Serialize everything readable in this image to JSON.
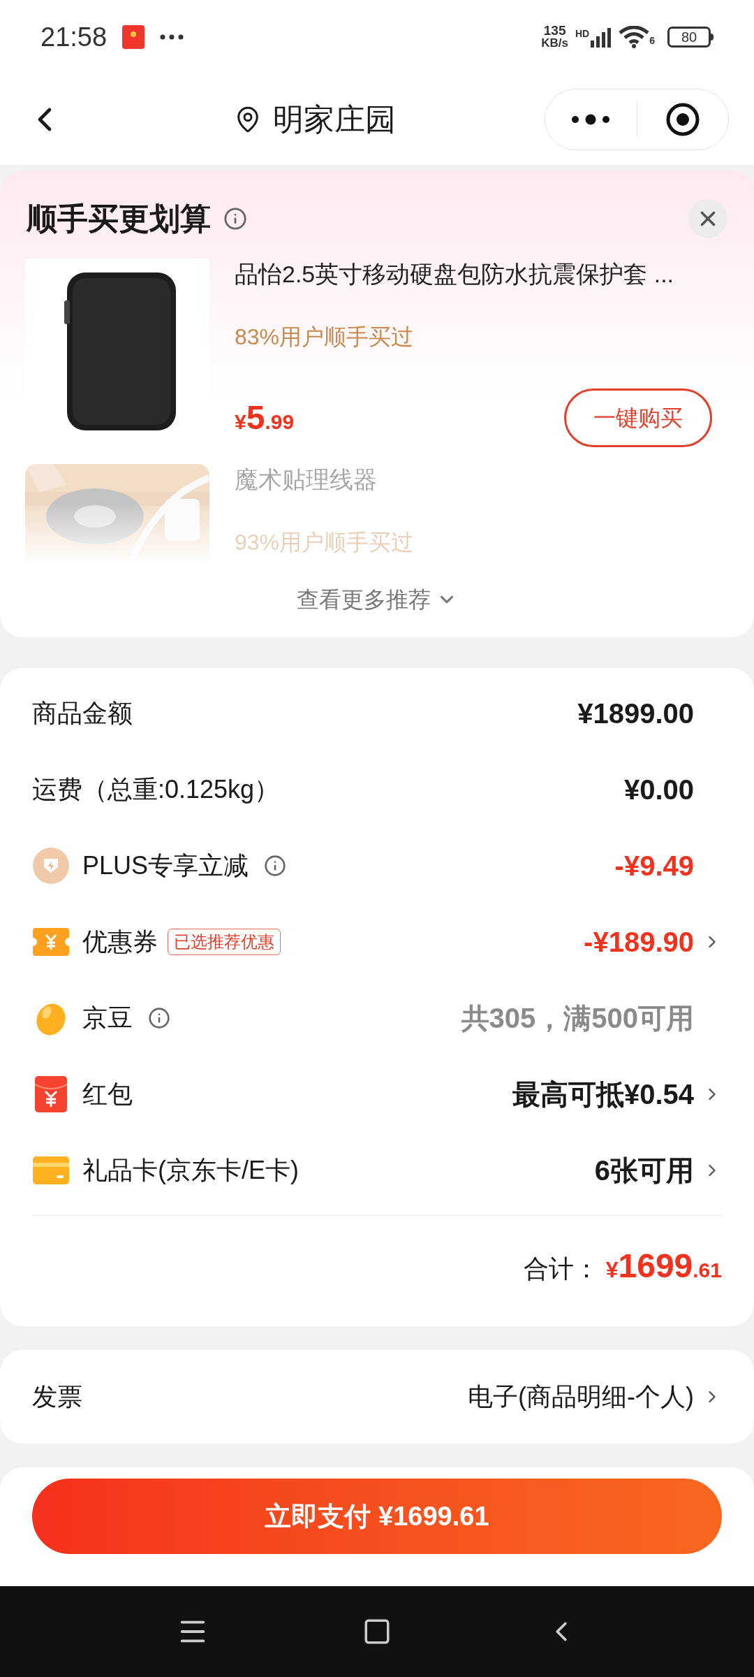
{
  "status_bar": {
    "time": "21:58",
    "net_speed": "135",
    "net_unit": "KB/s",
    "signal_label": "HD",
    "wifi_label": "6",
    "battery": "80"
  },
  "nav": {
    "title": "明家庄园"
  },
  "upsell": {
    "title": "顺手买更划算",
    "more": "查看更多推荐",
    "products": [
      {
        "name": "品怡2.5英寸移动硬盘包防水抗震保护套 ...",
        "stat": "83%用户顺手买过",
        "price_symbol": "¥",
        "price_integer": "5",
        "price_decimal": ".99",
        "button": "一键购买",
        "faded": false,
        "kind": "case"
      },
      {
        "name": "魔术贴理线器",
        "stat": "93%用户顺手买过",
        "faded": true,
        "kind": "tape"
      }
    ]
  },
  "summary": {
    "rows": [
      {
        "kind": "plain",
        "label": "商品金额",
        "value": "¥1899.00",
        "highlighted": false,
        "disabled": false,
        "info": false,
        "chevron": false
      },
      {
        "kind": "plain",
        "label": "运费（总重:0.125kg）",
        "value": "¥0.00",
        "highlighted": false,
        "disabled": false,
        "info": false,
        "chevron": false
      },
      {
        "kind": "plus",
        "label": "PLUS专享立减",
        "value": "-¥9.49",
        "highlighted": true,
        "disabled": false,
        "info": true,
        "chevron": false
      },
      {
        "kind": "coupon",
        "label": "优惠券",
        "badge": "已选推荐优惠",
        "value": "-¥189.90",
        "highlighted": true,
        "disabled": false,
        "info": false,
        "chevron": true
      },
      {
        "kind": "bean",
        "label": "京豆",
        "value": "共305，满500可用",
        "highlighted": false,
        "disabled": true,
        "info": true,
        "chevron": false
      },
      {
        "kind": "envelope",
        "label": "红包",
        "value": "最高可抵¥0.54",
        "highlighted": false,
        "disabled": false,
        "info": false,
        "chevron": true
      },
      {
        "kind": "card",
        "label": "礼品卡(京东卡/E卡)",
        "value": "6张可用",
        "highlighted": false,
        "disabled": false,
        "info": false,
        "chevron": true
      }
    ],
    "total_label": "合计：",
    "total_symbol": "¥",
    "total_integer": "1699",
    "total_decimal": ".61"
  },
  "invoice": {
    "label": "发票",
    "value": "电子(商品明细-个人)"
  },
  "pay_button": "立即支付 ¥1699.61"
}
